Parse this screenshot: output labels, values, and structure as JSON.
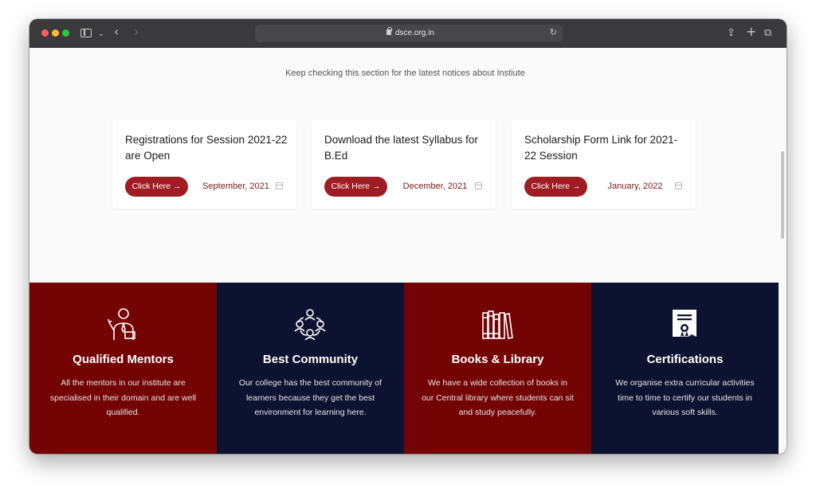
{
  "browser": {
    "url": "dsce.org.in"
  },
  "notices": {
    "subtitle": "Keep checking this section for the latest notices about Instiute",
    "cards": [
      {
        "title": "Registrations for Session 2021-22 are Open",
        "button": "Click Here →",
        "date": "September, 2021"
      },
      {
        "title": "Download the latest Syllabus for B.Ed",
        "button": "Click Here →",
        "date": "December, 2021"
      },
      {
        "title": "Scholarship Form Link for 2021-22 Session",
        "button": "Click Here →",
        "date": "January, 2022"
      }
    ]
  },
  "features": [
    {
      "icon": "mentor-icon",
      "title": "Qualified Mentors",
      "text": "All the mentors in our institute are specialised in their domain and are well qualified.",
      "color": "#740303"
    },
    {
      "icon": "community-icon",
      "title": "Best Community",
      "text": "Our college has the best community of learners because they get the best environment for learning here.",
      "color": "#0d1230"
    },
    {
      "icon": "books-icon",
      "title": "Books & Library",
      "text": "We have a wide collection of books in our Central library where students can sit and study peacefully.",
      "color": "#740303"
    },
    {
      "icon": "certificate-icon",
      "title": "Certifications",
      "text": "We organise extra curricular activities time to time to certify our students in various soft skills.",
      "color": "#0d1230"
    }
  ]
}
